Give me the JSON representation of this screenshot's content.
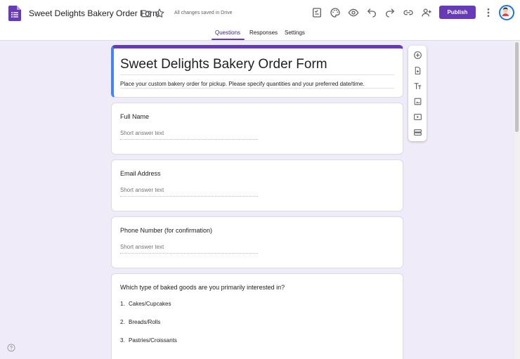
{
  "header": {
    "title": "Sweet Delights Bakery Order Form",
    "saved_status": "All changes saved in Drive",
    "publish_label": "Publish",
    "icons": [
      "forms-logo-icon",
      "folder-icon",
      "star-icon",
      "customize-theme-icon",
      "palette-icon",
      "preview-eye-icon",
      "undo-icon",
      "redo-icon",
      "link-icon",
      "add-collaborator-icon",
      "more-vert-icon"
    ]
  },
  "tabs": [
    {
      "label": "Questions",
      "active": true
    },
    {
      "label": "Responses",
      "active": false
    },
    {
      "label": "Settings",
      "active": false
    }
  ],
  "form": {
    "title": "Sweet Delights Bakery Order Form",
    "description": "Place your custom bakery order for pickup. Please specify quantities and your preferred date/time."
  },
  "questions": [
    {
      "label": "Full Name",
      "placeholder": "Short answer text"
    },
    {
      "label": "Email Address",
      "placeholder": "Short answer text"
    },
    {
      "label": "Phone Number (for confirmation)",
      "placeholder": "Short answer text"
    },
    {
      "label": "Which type of baked goods are you primarily interested in?",
      "options": [
        {
          "num": "1.",
          "text": "Cakes/Cupcakes"
        },
        {
          "num": "2.",
          "text": "Breads/Rolls"
        },
        {
          "num": "3.",
          "text": "Pastries/Croissants"
        }
      ]
    }
  ],
  "toolbar": [
    "add-question-icon",
    "import-questions-icon",
    "add-title-icon",
    "add-image-icon",
    "add-video-icon",
    "add-section-icon"
  ],
  "colors": {
    "accent": "#673ab7",
    "background": "#f0ebf8",
    "title_left_accent": "#4285f4"
  }
}
